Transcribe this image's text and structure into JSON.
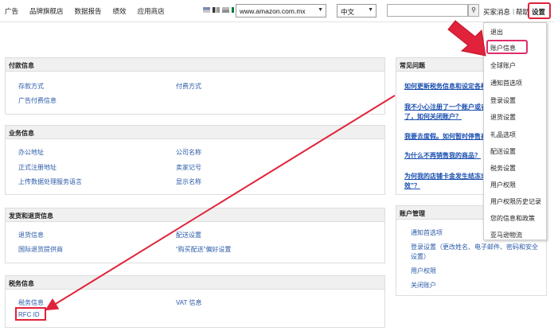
{
  "nav": [
    "广告",
    "品牌旗舰店",
    "数据报告",
    "绩效",
    "应用商店"
  ],
  "flag_icons": [
    "flag-icon-1",
    "flag-icon-2",
    "flag-icon-3",
    "mexico-flag-icon"
  ],
  "marketplace_select": "www.amazon.com.mx",
  "language_select": "中文",
  "search": {
    "value": "",
    "button_icon": "search-icon"
  },
  "top_links": {
    "buyer_messages": "买家消息",
    "help": "帮助",
    "settings": "设置"
  },
  "panels": {
    "payment": {
      "title": "付款信息",
      "items": [
        "存款方式",
        "付费方式",
        "广告付费信息"
      ]
    },
    "business": {
      "title": "业务信息",
      "items": [
        "办公地址",
        "公司名称",
        "正式注册地址",
        "卖家记号",
        "上传数据处理服务语言",
        "显示名称"
      ]
    },
    "shipping": {
      "title": "发货和退货信息",
      "items": [
        "退货信息",
        "配送设置",
        "国际退货提供商",
        "“购买配送”偏好设置"
      ]
    },
    "tax": {
      "title": "税务信息",
      "items": [
        "税务信息",
        "VAT 信息",
        "RFC ID"
      ]
    }
  },
  "faq": {
    "title": "常见问题",
    "links": [
      "如何更新税务信息和设定各种",
      "我不小心注册了一个账户或者",
      "了，如何关闭账户？",
      "我要去度假。如何暂时停售商",
      "为什么不再销售我的商品？",
      "为何我的店铺卡金发生结冻或",
      "效”？"
    ]
  },
  "account": {
    "title": "账户管理",
    "items": [
      "通知首选项",
      "登录设置（更改姓名、电子邮件、密码和安全",
      "设置）",
      "用户权限",
      "关闭账户"
    ]
  },
  "settings_menu": [
    "退出",
    "账户信息",
    "全球账户",
    "通知首选项",
    "登录设置",
    "退货设置",
    "礼品选项",
    "配送设置",
    "税务设置",
    "用户权限",
    "用户权限历史记录",
    "您的信息和政策",
    "亚马逊物流"
  ],
  "annotation_color": "#e0233a"
}
